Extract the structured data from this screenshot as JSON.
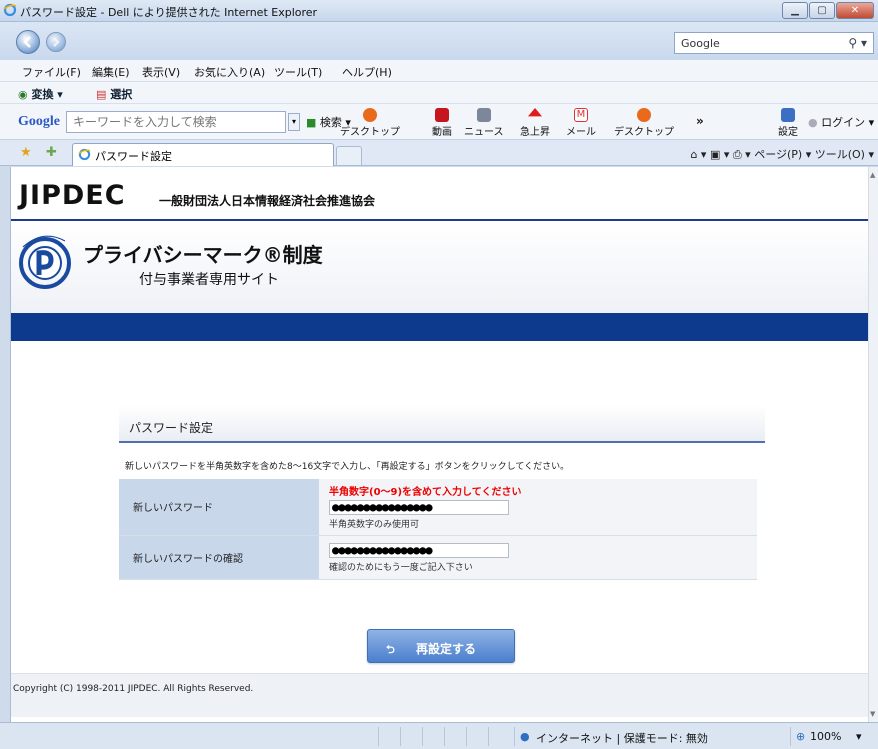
{
  "window": {
    "title": "パスワード設定 - Dell により提供された Internet Explorer"
  },
  "address": {
    "search_placeholder": "Google"
  },
  "menu": [
    "ファイル(F)",
    "編集(E)",
    "表示(V)",
    "お気に入り(A)",
    "ツール(T)",
    "ヘルプ(H)"
  ],
  "favbar": {
    "convert": "変換",
    "select": "選択"
  },
  "googlebar": {
    "logo": "Google",
    "placeholder": "キーワードを入力して検索",
    "search": "検索",
    "tools": [
      "デスクトップ",
      "動画",
      "ニュース",
      "急上昇",
      "メール",
      "デスクトップ"
    ],
    "more": "»",
    "settings": "設定",
    "login": "ログイン"
  },
  "tab": {
    "label": "パスワード設定"
  },
  "commandbar": "ページ(P) ▾  ツール(O) ▾",
  "page": {
    "logo_text": "JIPDEC",
    "org_name": "一般財団法人日本情報経済社会推進協会",
    "pmark_title": "プライバシーマーク®制度",
    "pmark_sub": "付与事業者専用サイト",
    "panel_title": "パスワード設定",
    "instructions": "新しいパスワードを半角英数字を含めた8～16文字で入力し、「再設定する」ボタンをクリックしてください。",
    "rows": [
      {
        "label": "新しいパスワード",
        "warning": "半角数字(0～9)を含めて入力してください",
        "masked": "●●●●●●●●●●●●●●●●",
        "hint": "半角英数字のみ使用可"
      },
      {
        "label": "新しいパスワードの確認",
        "masked": "●●●●●●●●●●●●●●●●",
        "hint": "確認のためにもう一度ご記入下さい"
      }
    ],
    "submit_label": "再設定する",
    "copyright": "Copyright (C) 1998-2011 JIPDEC. All Rights Reserved."
  },
  "status": {
    "zone": "インターネット | 保護モード: 無効",
    "zoom": "100%"
  },
  "colors": {
    "brand_navy": "#0d3a8c",
    "warning_red": "#e00000",
    "button_blue": "#4a7fcd"
  }
}
